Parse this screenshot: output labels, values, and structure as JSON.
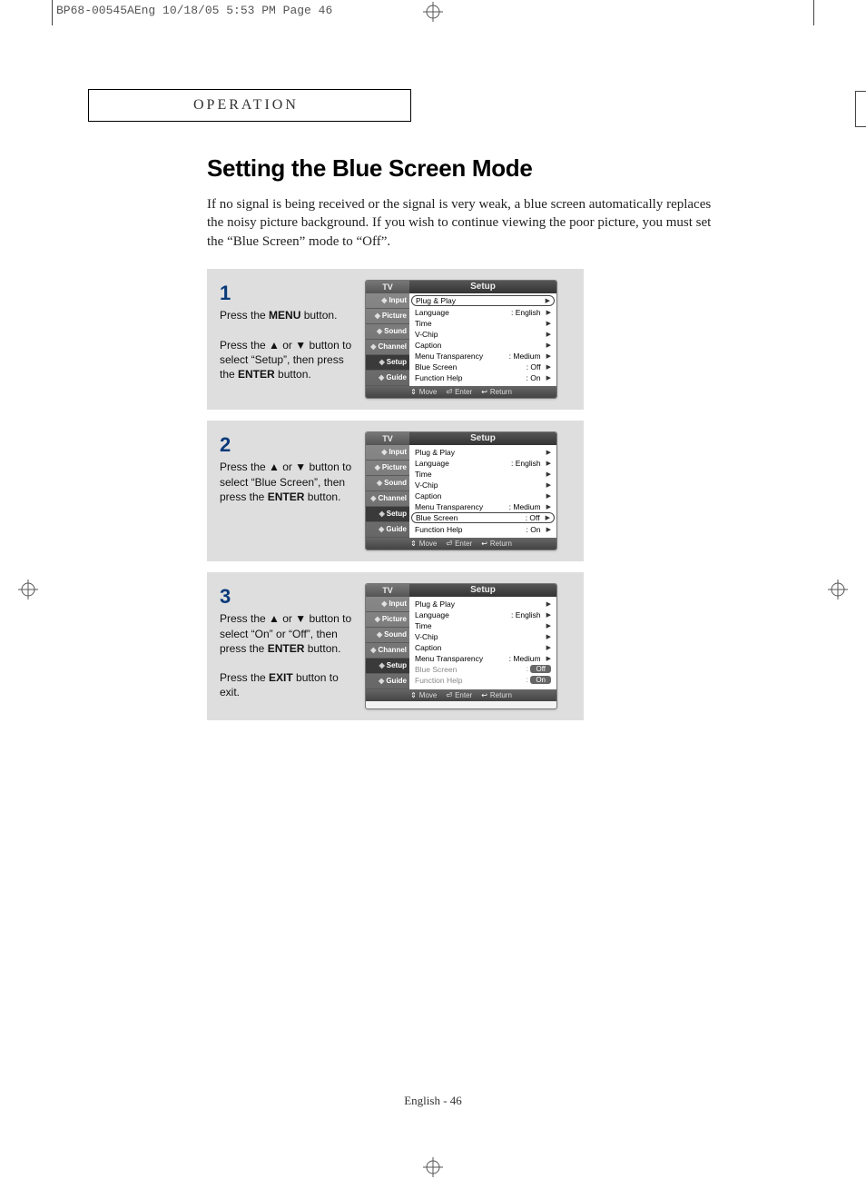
{
  "print_header": "BP68-00545AEng  10/18/05  5:53 PM  Page 46",
  "section_label": "OPERATION",
  "title": "Setting the Blue Screen Mode",
  "intro": "If no signal is being received or the signal is very weak, a blue screen automatically replaces the noisy picture background. If you wish to continue viewing the poor picture, you must set the “Blue Screen” mode to “Off”.",
  "steps": [
    {
      "num": "1",
      "text_html": "Press the <b>MENU</b> button.<br><br>Press the ▲ or ▼ button to select “Setup”, then press the <b>ENTER</b> button."
    },
    {
      "num": "2",
      "text_html": "Press the ▲ or ▼ button to select “Blue Screen”, then press the <b>ENTER</b> button."
    },
    {
      "num": "3",
      "text_html": "Press the ▲ or ▼ button to select “On” or “Off”, then press the <b>ENTER</b> button.<br><br>Press the <b>EXIT</b> button to exit."
    }
  ],
  "osd": {
    "tv_label": "TV",
    "menu_title": "Setup",
    "side_tabs": [
      "Input",
      "Picture",
      "Sound",
      "Channel",
      "Setup",
      "Guide"
    ],
    "footer": {
      "move": "Move",
      "enter": "Enter",
      "return": "Return"
    },
    "rows_base": [
      {
        "label": "Plug & Play",
        "value": ""
      },
      {
        "label": "Language",
        "value": ": English"
      },
      {
        "label": "Time",
        "value": ""
      },
      {
        "label": "V-Chip",
        "value": ""
      },
      {
        "label": "Caption",
        "value": ""
      },
      {
        "label": "Menu Transparency",
        "value": ": Medium"
      },
      {
        "label": "Blue Screen",
        "value": ": Off"
      },
      {
        "label": "Function Help",
        "value": ": On"
      }
    ],
    "screens": {
      "s1": {
        "boxed_index": 0
      },
      "s2": {
        "boxed_index": 6
      },
      "s3": {
        "dim_indices": [
          6,
          7
        ],
        "pills": {
          "6": "Off",
          "7": "On"
        },
        "override_values": {
          "5": ": Medium"
        }
      }
    }
  },
  "footer": "English - 46"
}
